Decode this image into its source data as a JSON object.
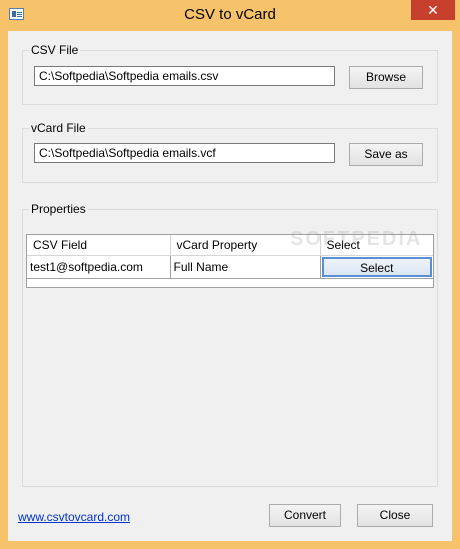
{
  "window": {
    "title": "CSV to vCard",
    "close_label": "✕"
  },
  "csv_file": {
    "label": "CSV File",
    "path": "C:\\Softpedia\\Softpedia emails.csv",
    "browse_label": "Browse"
  },
  "vcard_file": {
    "label": "vCard File",
    "path": "C:\\Softpedia\\Softpedia emails.vcf",
    "save_label": "Save as"
  },
  "properties": {
    "label": "Properties",
    "columns": [
      "CSV Field",
      "vCard Property",
      "Select"
    ],
    "rows": [
      {
        "csv_field": "test1@softpedia.com",
        "vcard_property": "Full Name",
        "action": "Select"
      }
    ]
  },
  "watermark": "SOFTPEDIA",
  "footer": {
    "link": "www.csvtovcard.com",
    "convert_label": "Convert",
    "close_label": "Close"
  }
}
